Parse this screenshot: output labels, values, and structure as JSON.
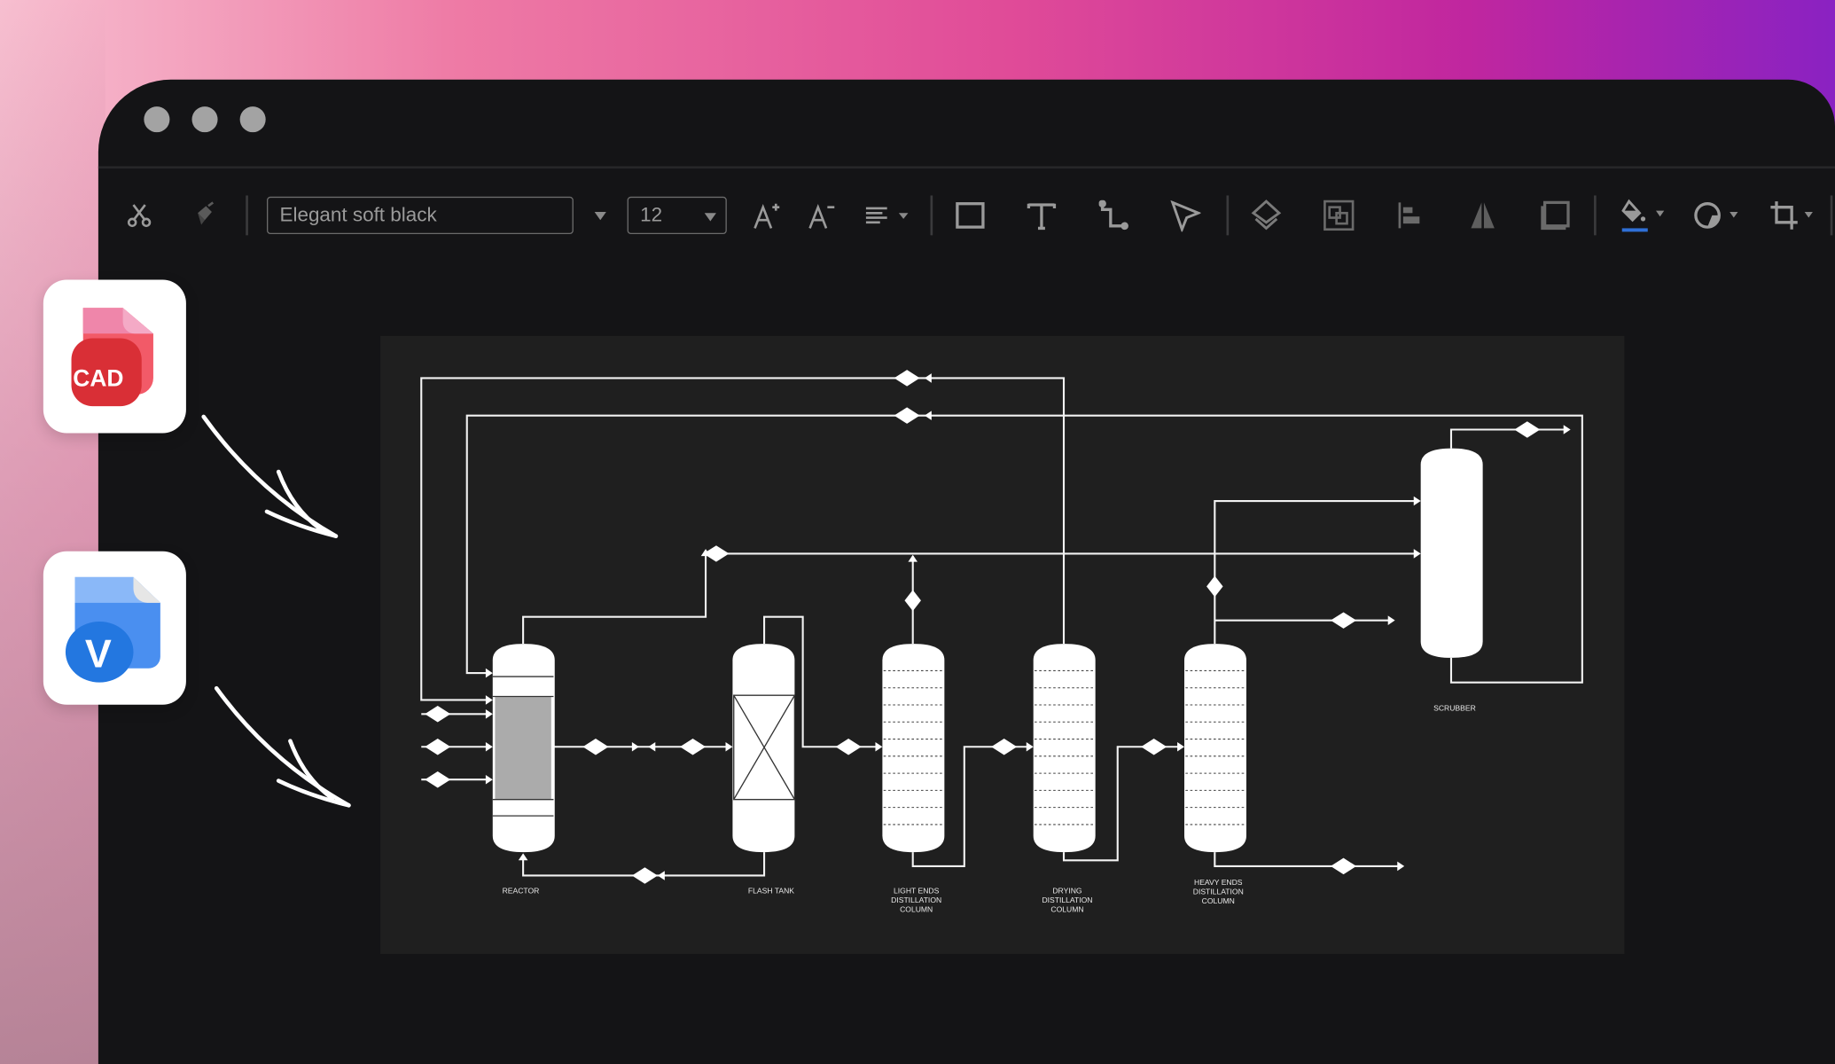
{
  "window": {
    "controls": [
      "close",
      "minimize",
      "maximize"
    ]
  },
  "toolbar": {
    "font_name": "Elegant soft black",
    "font_size": "12",
    "icons": [
      "scissors-icon",
      "format-painter-icon",
      "chevron-down-icon",
      "font-increase-icon",
      "font-decrease-icon",
      "align-icon",
      "rectangle-icon",
      "text-icon",
      "connector-icon",
      "pointer-icon",
      "layers-icon",
      "group-icon",
      "align-left-icon",
      "flip-icon",
      "frame-icon",
      "fill-color-icon",
      "shape-icon",
      "crop-icon"
    ],
    "fill_color": "#2f6fd6"
  },
  "badges": {
    "cad": "CAD",
    "visio": "V"
  },
  "diagram": {
    "labels": {
      "reactor": "REACTOR",
      "flash_tank": "FLASH TANK",
      "light_ends": [
        "LIGHT ENDS",
        "DISTILLATION",
        "COLUMN"
      ],
      "drying": [
        "DRYING",
        "DISTILLATION",
        "COLUMN"
      ],
      "heavy_ends": [
        "HEAVY ENDS",
        "DISTILLATION",
        "COLUMN"
      ],
      "scrubber": "SCRUBBER"
    }
  }
}
